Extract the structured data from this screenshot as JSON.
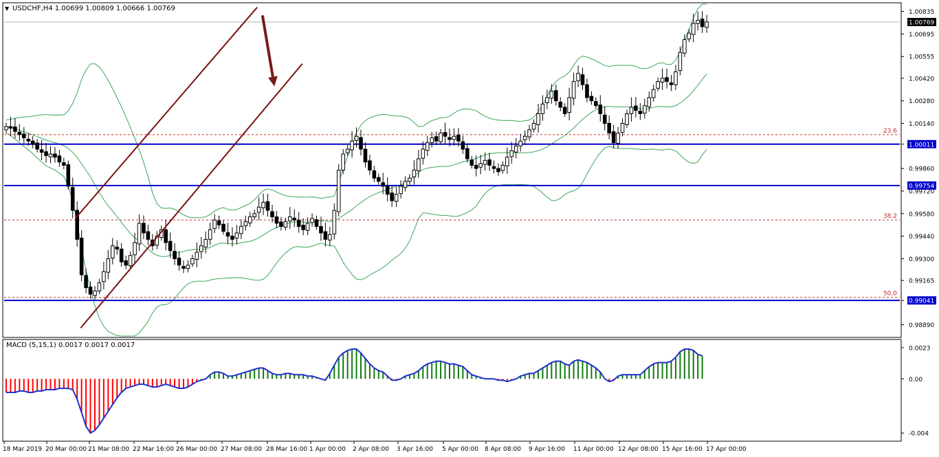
{
  "symbol_header": "USDCHF,H4  1.00699 1.00809 1.00666 1.00769",
  "macd_header": "MACD (5,15,1) 0.0017 0.0017 0.0017",
  "colors": {
    "bull_candle": "#ffffff",
    "bear_candle": "#000000",
    "bollinger": "#3aa655",
    "channel": "#7a1010",
    "horizontal_level": "#0000cc",
    "fib_level": "#c62828",
    "macd_line": "#1f2fcc",
    "hist_positive": "#107a10",
    "hist_negative": "#ff0000",
    "arrow": "#7a1a1a"
  },
  "chart_data": [
    {
      "type": "candlestick",
      "symbol": "USDCHF",
      "timeframe": "H4",
      "ohlc": {
        "open": 1.00699,
        "high": 1.00809,
        "low": 1.00666,
        "close": 1.00769
      },
      "current_price": "1.00769",
      "y_ticks": [
        "1.00835",
        "1.00695",
        "1.00555",
        "1.00420",
        "1.00280",
        "1.00140",
        "1.00011",
        "0.99860",
        "0.99720",
        "0.99580",
        "0.99440",
        "0.99300",
        "0.99165",
        "0.99041",
        "0.98890"
      ],
      "x_ticks": [
        "18 Mar 2019",
        "20 Mar 00:00",
        "21 Mar 08:00",
        "22 Mar 16:00",
        "26 Mar 00:00",
        "27 Mar 08:00",
        "28 Mar 16:00",
        "1 Apr 00:00",
        "2 Apr 08:00",
        "3 Apr 16:00",
        "5 Apr 00:00",
        "8 Apr 08:00",
        "9 Apr 16:00",
        "11 Apr 00:00",
        "12 Apr 08:00",
        "15 Apr 16:00",
        "17 Apr 00:00"
      ],
      "ylim": [
        0.9882,
        1.0088
      ],
      "horizontal_levels": [
        {
          "price": 1.00011,
          "label": "1.00011"
        },
        {
          "price": 0.99754,
          "label": "0.99754"
        },
        {
          "price": 0.99041,
          "label": "0.99041"
        }
      ],
      "fib_levels": [
        {
          "label": "23.6",
          "price": 1.0007
        },
        {
          "label": "38.2",
          "price": 0.9954
        },
        {
          "label": "50.0",
          "price": 0.9906
        }
      ],
      "channel": {
        "upper": [
          [
            15.6,
            0.9955
          ],
          [
            56.6,
            1.0086
          ]
        ],
        "lower": [
          [
            16.8,
            0.9887
          ],
          [
            66.8,
            1.0051
          ]
        ]
      },
      "arrow": {
        "from": [
          57.8,
          1.0081
        ],
        "to": [
          60.5,
          1.0037
        ]
      },
      "closes": [
        1.0012,
        1.0011,
        1.0009,
        1.0007,
        1.0005,
        1.0003,
        1.0001,
        0.9998,
        0.9996,
        0.9994,
        0.9995,
        0.9993,
        0.999,
        0.9988,
        0.9975,
        0.996,
        0.9942,
        0.992,
        0.9912,
        0.9908,
        0.991,
        0.9915,
        0.9922,
        0.993,
        0.9938,
        0.9936,
        0.9928,
        0.9926,
        0.9932,
        0.994,
        0.9952,
        0.9946,
        0.9942,
        0.9938,
        0.9944,
        0.9948,
        0.994,
        0.9935,
        0.993,
        0.9926,
        0.9924,
        0.9926,
        0.993,
        0.9934,
        0.9938,
        0.9942,
        0.9948,
        0.9954,
        0.9951,
        0.9947,
        0.9944,
        0.9942,
        0.9946,
        0.995,
        0.9953,
        0.9956,
        0.9958,
        0.9962,
        0.9965,
        0.996,
        0.9956,
        0.9952,
        0.995,
        0.9953,
        0.9956,
        0.9954,
        0.995,
        0.9948,
        0.9952,
        0.9955,
        0.995,
        0.9946,
        0.9942,
        0.9945,
        0.996,
        0.9985,
        0.9995,
        0.9998,
        1.0003,
        1.0006,
        0.9998,
        0.999,
        0.9985,
        0.998,
        0.9978,
        0.9975,
        0.997,
        0.9966,
        0.997,
        0.9975,
        0.9978,
        0.998,
        0.9985,
        0.9992,
        0.9998,
        1.0002,
        1.0005,
        1.0003,
        1.0008,
        1.0006,
        1.0004,
        1.0006,
        1.0003,
        0.9998,
        0.9992,
        0.9988,
        0.9986,
        0.9989,
        0.9991,
        0.9988,
        0.9986,
        0.9984,
        0.9988,
        0.9993,
        0.9997,
        1.0,
        1.0003,
        1.0006,
        1.001,
        1.0014,
        1.002,
        1.0026,
        1.003,
        1.0034,
        1.0028,
        1.0024,
        1.002,
        1.003,
        1.004,
        1.0045,
        1.0038,
        1.003,
        1.0028,
        1.0025,
        1.002,
        1.0014,
        1.0008,
        1.0002,
        1.0008,
        1.0014,
        1.002,
        1.0024,
        1.0022,
        1.002,
        1.0025,
        1.003,
        1.0035,
        1.004,
        1.0042,
        1.004,
        1.0038,
        1.0046,
        1.0058,
        1.0066,
        1.007,
        1.0076,
        1.0078,
        1.0074,
        1.0077
      ]
    },
    {
      "type": "bar",
      "name": "MACD (5,15,1)",
      "y_ticks": [
        "0.0023",
        "0.00",
        "-0.004"
      ],
      "ylim": [
        -0.0044,
        0.0026
      ],
      "values": [
        -0.001,
        -0.001,
        -0.001,
        -0.0009,
        -0.0009,
        -0.001,
        -0.001,
        -0.0009,
        -0.0009,
        -0.0008,
        -0.0008,
        -0.0008,
        -0.0007,
        -0.0007,
        -0.0007,
        -0.0008,
        -0.0015,
        -0.0025,
        -0.0035,
        -0.004,
        -0.0038,
        -0.0034,
        -0.0029,
        -0.0024,
        -0.0019,
        -0.0014,
        -0.001,
        -0.0007,
        -0.0006,
        -0.0005,
        -0.0004,
        -0.0004,
        -0.0005,
        -0.0006,
        -0.0006,
        -0.0005,
        -0.0004,
        -0.0005,
        -0.0006,
        -0.0007,
        -0.0007,
        -0.0006,
        -0.0004,
        -0.0002,
        -0.0001,
        0.0,
        0.0003,
        0.0005,
        0.0005,
        0.0004,
        0.0002,
        0.0002,
        0.0003,
        0.0004,
        0.0005,
        0.0006,
        0.0007,
        0.0008,
        0.0008,
        0.0006,
        0.0004,
        0.0003,
        0.0003,
        0.0004,
        0.0004,
        0.0003,
        0.0003,
        0.0003,
        0.0002,
        0.0002,
        0.0001,
        0.0,
        -0.0001,
        0.0004,
        0.001,
        0.0016,
        0.0019,
        0.0021,
        0.0022,
        0.0022,
        0.0019,
        0.0015,
        0.0011,
        0.0008,
        0.0006,
        0.0005,
        0.0002,
        -0.0001,
        -0.0001,
        0.0,
        0.0002,
        0.0003,
        0.0004,
        0.0006,
        0.0009,
        0.0011,
        0.0012,
        0.0013,
        0.0013,
        0.0012,
        0.0011,
        0.0011,
        0.001,
        0.0009,
        0.0006,
        0.0003,
        0.0002,
        0.0001,
        0.0,
        0.0,
        0.0,
        -0.0001,
        -0.0001,
        -0.0002,
        -0.0001,
        0.0,
        0.0002,
        0.0003,
        0.0004,
        0.0004,
        0.0006,
        0.0008,
        0.001,
        0.0012,
        0.0013,
        0.0013,
        0.0011,
        0.001,
        0.0013,
        0.0014,
        0.0013,
        0.0012,
        0.001,
        0.0008,
        0.0005,
        0.0,
        -0.0002,
        -0.0001,
        0.0002,
        0.0003,
        0.0003,
        0.0003,
        0.0003,
        0.0003,
        0.0006,
        0.0009,
        0.0011,
        0.0012,
        0.0012,
        0.0012,
        0.0013,
        0.0016,
        0.002,
        0.0022,
        0.0022,
        0.0021,
        0.0018,
        0.0017
      ]
    }
  ]
}
